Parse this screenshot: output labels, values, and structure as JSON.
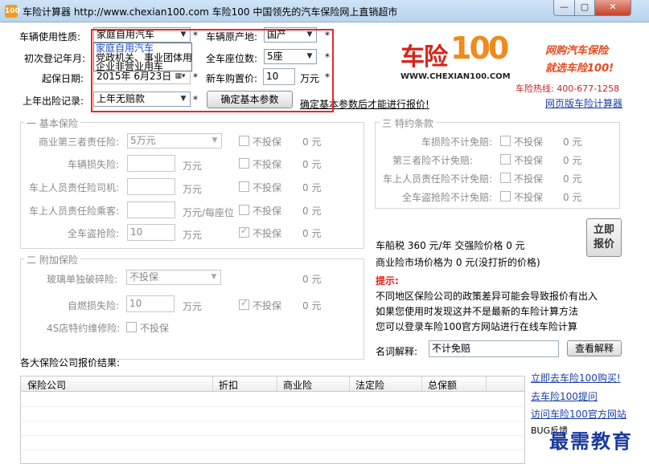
{
  "window": {
    "title": "车险计算器 http://www.chexian100.com 车险100 中国领先的汽车保险网上直销超市",
    "icon_name": "app-logo-icon",
    "controls": [
      "—",
      "▢",
      "✕"
    ]
  },
  "basic": {
    "usage_label": "车辆使用性质:",
    "usage_value": "家庭自用汽车",
    "origin_label": "车辆原产地:",
    "origin_value": "国产",
    "reg_date_label": "初次登记年月:",
    "seats_label": "全车座位数:",
    "seats_value": "5座",
    "start_date_label": "起保日期:",
    "start_date_value": "2015年 6月23日",
    "new_price_label": "新车购置价:",
    "new_price_value": "10",
    "new_price_unit": "万元",
    "last_claim_label": "上年出险记录:",
    "last_claim_value": "上年无赔款",
    "confirm_button": "确定基本参数",
    "confirm_hint": "确定基本参数后才能进行报价!",
    "required_mark": "*"
  },
  "usage_dropdown": {
    "options": [
      "家庭自用汽车",
      "党政机关、事业团体用",
      "企业非营业用车"
    ]
  },
  "ad": {
    "logo_text_a": "车险",
    "logo_text_b": "100",
    "logo_url": "WWW.CHEXIAN100.COM",
    "slogan1": "网购汽车保险",
    "slogan2": "就选车险100!",
    "hotline": "车险热线: 400-677-1258",
    "web_calc_link": "网页版车险计算器"
  },
  "basic_ins": {
    "group_title": "一 基本保险",
    "rows": [
      {
        "label": "商业第三者责任险:",
        "field": "5万元",
        "unit": "",
        "check": "不投保",
        "checked": false,
        "price": "0 元"
      },
      {
        "label": "车辆损失险:",
        "field": "",
        "unit": "万元",
        "check": "不投保",
        "checked": false,
        "price": "0 元"
      },
      {
        "label": "车上人员责任险司机:",
        "field": "",
        "unit": "万元",
        "check": "不投保",
        "checked": false,
        "price": "0 元"
      },
      {
        "label": "车上人员责任险乘客:",
        "field": "",
        "unit": "万元/每座位",
        "check": "不投保",
        "checked": false,
        "price": "0 元"
      },
      {
        "label": "全车盗抢险:",
        "field": "10",
        "unit": "万元",
        "check": "不投保",
        "checked": true,
        "price": "0 元"
      }
    ]
  },
  "special": {
    "group_title": "三 特约条款",
    "rows": [
      {
        "label": "车损险不计免赔:",
        "check": "不投保",
        "price": "0 元"
      },
      {
        "label": "第三者险不计免赔:",
        "check": "不投保",
        "price": "0 元"
      },
      {
        "label": "车上人员责任险不计免赔:",
        "check": "不投保",
        "price": "0 元"
      },
      {
        "label": "全车盗抢险不计免赔:",
        "check": "不投保",
        "price": "0 元"
      }
    ]
  },
  "addon": {
    "group_title": "二 附加保险",
    "glass_label": "玻璃单独破碎险:",
    "glass_value": "不投保",
    "glass_price": "0 元",
    "fire_label": "自燃损失险:",
    "fire_value": "10",
    "fire_unit": "万元",
    "fire_check": "不投保",
    "fire_price": "0 元",
    "repair_label": "4S店特约维修险:",
    "repair_check": "不投保"
  },
  "summary": {
    "line1": "车船税 360 元/年   交强险价格 0 元",
    "line2": "商业险市场价格为 0 元(没打折的价格)",
    "quote_button": "立即\n报价",
    "quote_line1": "立即",
    "quote_line2": "报价",
    "tip_title": "提示:",
    "tips": [
      "不同地区保险公司的政策差异可能会导致报价有出入",
      "如果您使用时发现这并不是最新的车险计算方法",
      "您可以登录车险100官方网站进行在线车险计算"
    ],
    "term_label": "名词解释:",
    "term_value": "不计免赔",
    "term_button": "查看解释"
  },
  "results": {
    "title": "各大保险公司报价结果:",
    "columns": [
      "保险公司",
      "折扣",
      "商业险",
      "法定险",
      "总保额"
    ]
  },
  "side_links": {
    "buy": "立即去车险100购买!",
    "ask": "去车险100提问",
    "visit": "访问车险100官方网站",
    "bug": "BUG反馈"
  },
  "watermark": "最需教育"
}
